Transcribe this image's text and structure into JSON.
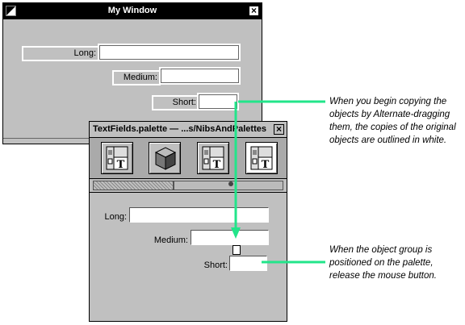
{
  "my_window": {
    "title": "My Window",
    "fields": [
      {
        "label": "Long:"
      },
      {
        "label": "Medium:"
      },
      {
        "label": "Short:"
      }
    ]
  },
  "palette": {
    "title": "TextFields.palette  —  ...s/NibsAndPalettes",
    "toolbar_icons": [
      "textfield-palette-icon",
      "cube-icon",
      "textfield-palette-icon",
      "textfield-palette-icon"
    ],
    "fields": [
      {
        "label": "Long:"
      },
      {
        "label": "Medium:"
      },
      {
        "label": "Short:"
      }
    ]
  },
  "annotations": {
    "top": [
      "When you begin copying the",
      "objects by Alternate-dragging",
      "them, the copies of the original",
      "objects are outlined in white."
    ],
    "bottom": [
      "When the object group is",
      "positioned on the palette,",
      "release the mouse button."
    ]
  },
  "colors": {
    "arrow": "#22e58a",
    "window_bg": "#c0c0c0",
    "titlebar": "#000000"
  }
}
